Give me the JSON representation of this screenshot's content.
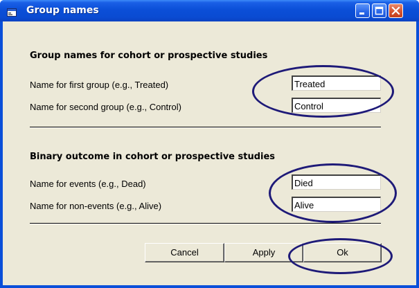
{
  "window": {
    "title": "Group names"
  },
  "group_section": {
    "title": "Group names for cohort or prospective studies",
    "first_label": "Name for first group (e.g., Treated)",
    "first_value": "Treated",
    "second_label": "Name for second group (e.g., Control)",
    "second_value": "Control"
  },
  "outcome_section": {
    "title": "Binary outcome in cohort or prospective studies",
    "events_label": "Name for events (e.g., Dead)",
    "events_value": "Died",
    "nonevents_label": "Name for non-events (e.g., Alive)",
    "nonevents_value": "Alive"
  },
  "buttons": {
    "cancel": "Cancel",
    "apply": "Apply",
    "ok": "Ok"
  },
  "colors": {
    "title_bar": "#0a4fd9",
    "dialog_face": "#ece9d8",
    "highlight_ellipse": "#1e1a78",
    "close_button": "#d7542f"
  },
  "icons": [
    "window-app-icon",
    "minimize-icon",
    "maximize-icon",
    "close-icon"
  ]
}
